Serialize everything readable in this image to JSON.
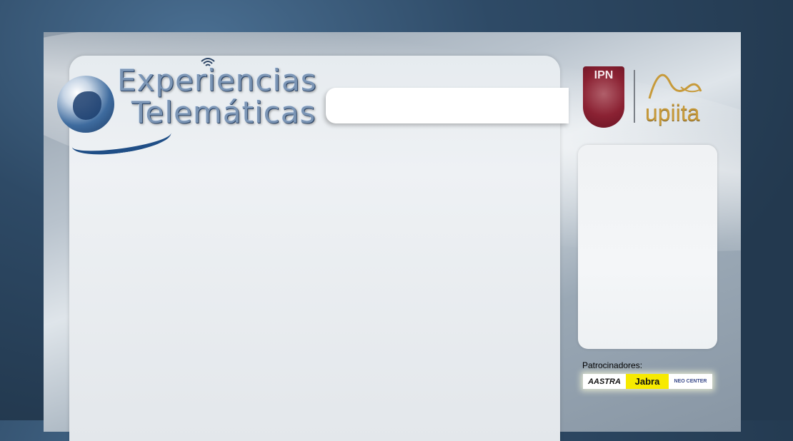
{
  "header": {
    "logo_line1": "Experiencias",
    "logo_line2": "Telemáticas",
    "institution_logo": "IPN",
    "school_logo": "upiita"
  },
  "sidebar": {
    "sponsors_label": "Patrocinadores:",
    "sponsors": [
      "AASTRA",
      "Jabra",
      "NEO CENTER"
    ]
  },
  "colors": {
    "background": "#2e4a66",
    "ipn_maroon": "#8b2233",
    "upiita_gold": "#c79a3a",
    "jabra_yellow": "#f7ea00"
  }
}
